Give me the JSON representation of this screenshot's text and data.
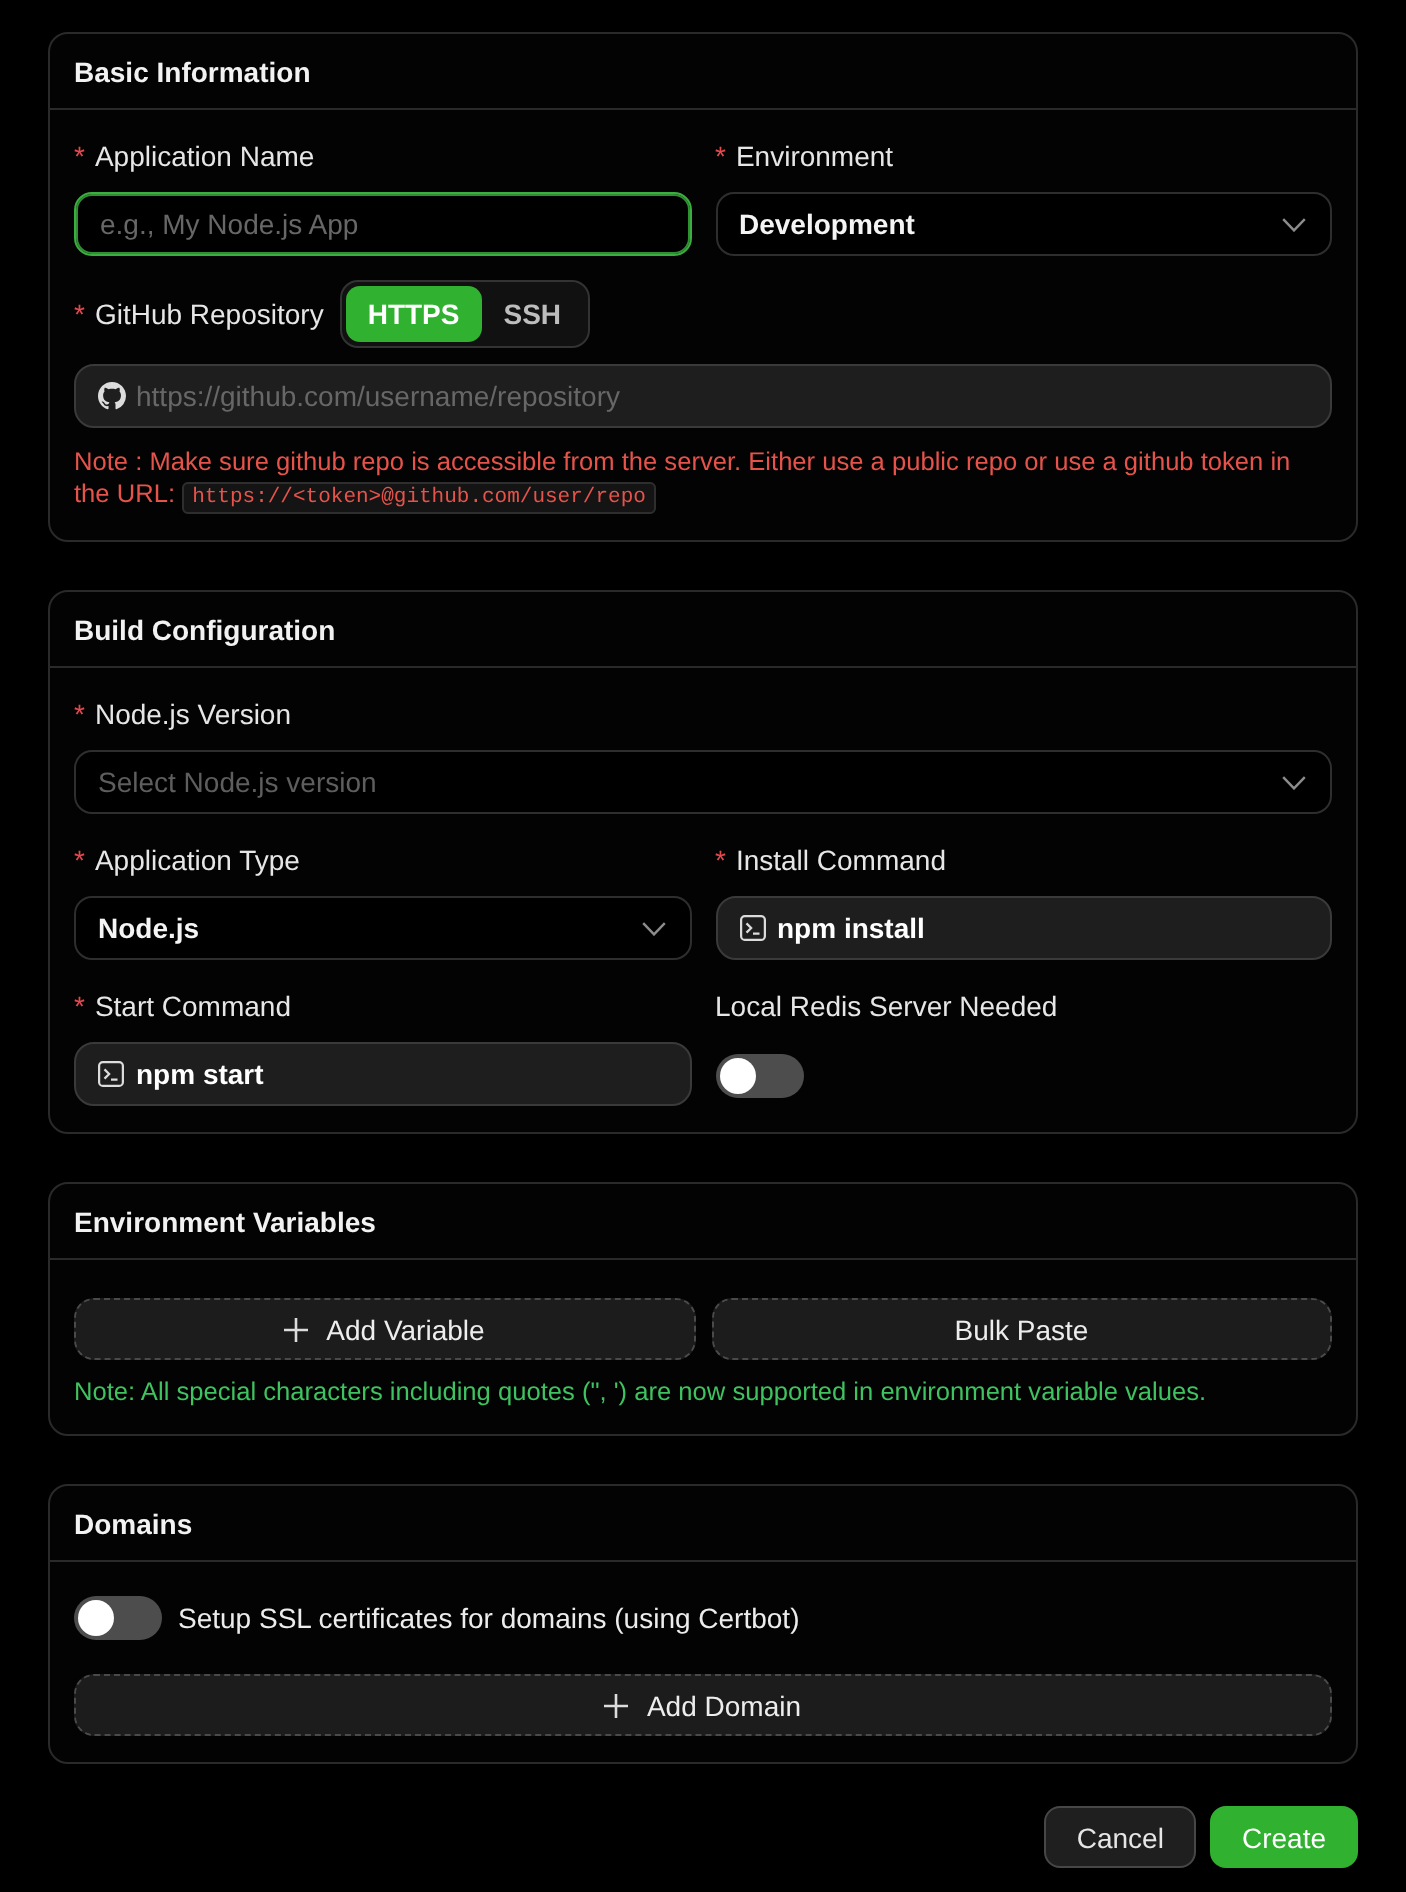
{
  "sections": [
    {
      "title": "Basic Information",
      "items": [
        {
          "kind": "columns",
          "fields": [
            {
              "kind": "text",
              "required_mark": "*",
              "label": "Application Name",
              "placeholder": "e.g., My Node.js App",
              "focused": true
            },
            {
              "kind": "select",
              "required_mark": "*",
              "label": "Environment",
              "value": "Development"
            }
          ]
        },
        {
          "kind": "columns",
          "fields": [
            {
              "kind": "repo",
              "required_mark": "*",
              "label": "GitHub Repository",
              "protocols": [
                {
                  "label": "HTTPS",
                  "selected": true
                },
                {
                  "label": "SSH",
                  "selected": false
                }
              ],
              "placeholder": "https://github.com/username/repository",
              "note": {
                "kind": "error",
                "text": "Note : Make sure github repo is accessible from the server. Either use a public repo or use a github token in the URL:",
                "code": "https://<token>@github.com/user/repo"
              }
            }
          ]
        }
      ]
    },
    {
      "title": "Build Configuration",
      "items": [
        {
          "kind": "columns",
          "fields": [
            {
              "kind": "select",
              "required_mark": "*",
              "label": "Node.js Version",
              "placeholder": "Select Node.js version"
            }
          ]
        },
        {
          "kind": "columns",
          "fields": [
            {
              "kind": "select",
              "required_mark": "*",
              "label": "Application Type",
              "value": "Node.js"
            },
            {
              "kind": "command",
              "required_mark": "*",
              "label": "Install Command",
              "value": "npm install"
            }
          ]
        },
        {
          "kind": "columns",
          "fields": [
            {
              "kind": "command",
              "required_mark": "*",
              "label": "Start Command",
              "value": "npm start"
            },
            {
              "kind": "switch",
              "label": "Local Redis Server Needed",
              "on": false
            }
          ]
        }
      ]
    },
    {
      "title": "Environment Variables",
      "items": [
        {
          "kind": "buttons",
          "buttons": [
            {
              "kind": "add",
              "label": "Add Variable"
            },
            {
              "kind": "paste",
              "label": "Bulk Paste"
            }
          ]
        },
        {
          "kind": "success_note",
          "text": "Note: All special characters including quotes (\", ') are now supported in environment variable values."
        }
      ]
    },
    {
      "title": "Domains",
      "items": [
        {
          "kind": "switch_row",
          "label": "Setup SSL certificates for domains (using Certbot)",
          "on": false
        },
        {
          "kind": "buttons",
          "buttons": [
            {
              "kind": "add",
              "label": "Add Domain"
            }
          ]
        }
      ]
    }
  ],
  "actions": [
    {
      "kind": "cancel",
      "label": "Cancel"
    },
    {
      "kind": "submit",
      "label": "Create"
    }
  ]
}
